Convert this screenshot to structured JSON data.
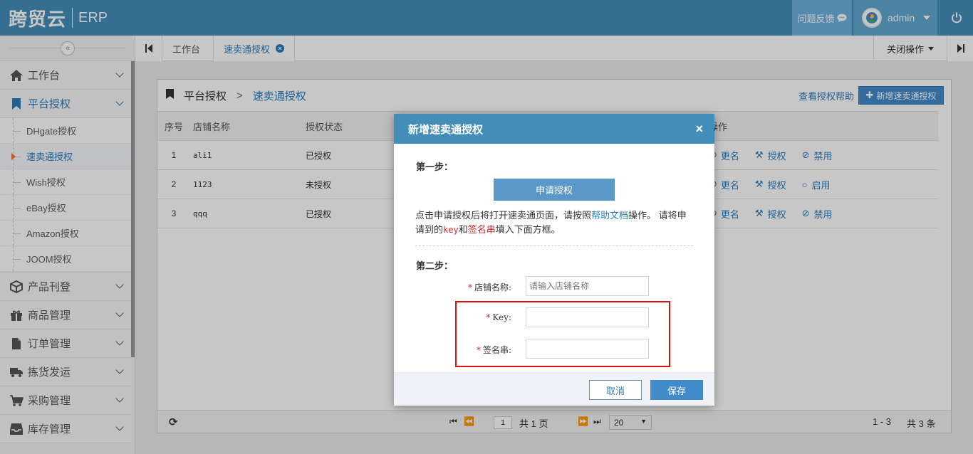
{
  "header": {
    "brand": "跨贸云",
    "erp": "ERP",
    "feedback": "问题反馈",
    "user": "admin"
  },
  "sidebar": {
    "items": [
      {
        "label": "工作台",
        "icon": "home-icon"
      },
      {
        "label": "平台授权",
        "icon": "bookmark-icon",
        "open": true
      },
      {
        "label": "产品刊登",
        "icon": "cube-icon"
      },
      {
        "label": "商品管理",
        "icon": "gift-icon"
      },
      {
        "label": "订单管理",
        "icon": "file-icon"
      },
      {
        "label": "拣货发运",
        "icon": "truck-icon"
      },
      {
        "label": "采购管理",
        "icon": "cart-icon"
      },
      {
        "label": "库存管理",
        "icon": "inbox-icon"
      }
    ],
    "subitems": [
      "DHgate授权",
      "速卖通授权",
      "Wish授权",
      "eBay授权",
      "Amazon授权",
      "JOOM授权"
    ]
  },
  "tabs": {
    "workbench": "工作台",
    "current": "速卖通授权",
    "close_ops": "关闭操作"
  },
  "panel": {
    "breadcrumb_parent": "平台授权",
    "breadcrumb_sep": ">",
    "breadcrumb_current": "速卖通授权",
    "help_link": "查看授权帮助",
    "add_button": "新增速卖通授权",
    "columns": [
      "序号",
      "店铺名称",
      "授权状态",
      "操作"
    ],
    "rows": [
      {
        "no": "1",
        "name": "ali1",
        "status": "已授权",
        "ops": [
          "更名",
          "授权",
          "禁用"
        ]
      },
      {
        "no": "2",
        "name": "1123",
        "status": "未授权",
        "ops": [
          "更名",
          "授权",
          "启用"
        ]
      },
      {
        "no": "3",
        "name": "qqq",
        "status": "已授权",
        "ops": [
          "更名",
          "授权",
          "禁用"
        ]
      }
    ],
    "pager": {
      "page": "1",
      "total_pages_text": "共 1 页",
      "page_size": "20",
      "range_text": "1 - 3",
      "total_text": "共 3 条"
    }
  },
  "modal": {
    "title": "新增速卖通授权",
    "close": "×",
    "step1": "第一步：",
    "apply_button": "申请授权",
    "desc_a": "点击申请授权后将打开速卖通页面，请按照",
    "desc_link": "帮助文档",
    "desc_b": "操作。  请将申请到的",
    "desc_key": "key",
    "desc_c": "和",
    "desc_sig": "签名串",
    "desc_d": "填入下面方框。",
    "step2": "第二步：",
    "shop_label": "店铺名称:",
    "shop_placeholder": "请输入店铺名称",
    "key_label": "Key:",
    "sig_label": "签名串:",
    "cancel": "取消",
    "save": "保存"
  },
  "colors": {
    "header": "#438eb9",
    "accent": "#2b7dbc",
    "highlight_box": "#e01010"
  }
}
